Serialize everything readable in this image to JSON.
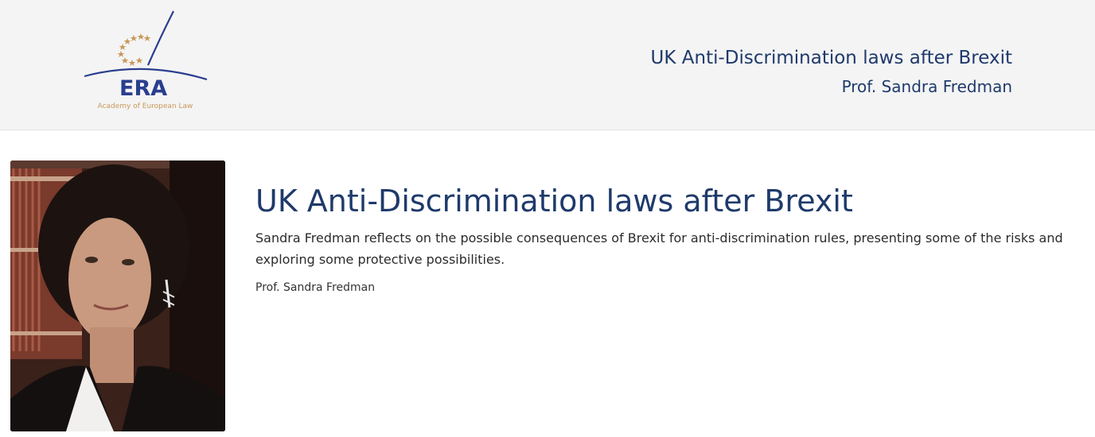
{
  "header": {
    "logo": {
      "wordmark": "ERA",
      "caption": "Academy of European Law"
    },
    "title": "UK Anti-Discrimination laws after Brexit",
    "subtitle": "Prof. Sandra Fredman"
  },
  "main": {
    "title": "UK Anti-Discrimination laws after Brexit",
    "description": "Sandra Fredman reflects on the possible consequences of Brexit for anti-discrimination rules, presenting some of the risks and exploring some protective possibilities.",
    "author": "Prof. Sandra Fredman",
    "photo_icon": "speaker-portrait"
  },
  "colors": {
    "brand_blue": "#1f3a6b",
    "logo_gold": "#c9995a",
    "header_bg": "#f4f4f4"
  }
}
